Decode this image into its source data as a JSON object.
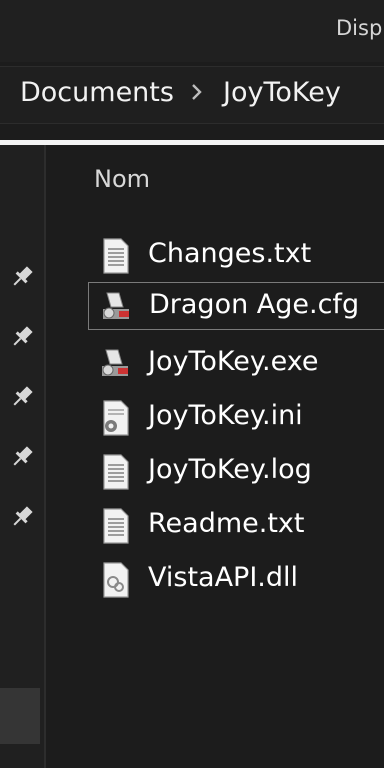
{
  "window": {
    "truncated_title": "Disp"
  },
  "address_bar": {
    "crumbs": [
      "Documents",
      "JoyToKey"
    ]
  },
  "file_list": {
    "column_header": "Nom",
    "files": [
      {
        "name": "Changes.txt",
        "icon": "text-file-icon"
      },
      {
        "name": "Dragon Age.cfg",
        "icon": "config-file-icon"
      },
      {
        "name": "JoyToKey.exe",
        "icon": "application-icon"
      },
      {
        "name": "JoyToKey.ini",
        "icon": "settings-file-icon"
      },
      {
        "name": "JoyToKey.log",
        "icon": "text-file-icon"
      },
      {
        "name": "Readme.txt",
        "icon": "text-file-icon"
      },
      {
        "name": "VistaAPI.dll",
        "icon": "dll-file-icon"
      }
    ],
    "focused_index": 1
  },
  "nav_pane": {
    "pin_icon": "pin-icon",
    "pin_count": 5
  },
  "colors": {
    "background": "#1c1c1c",
    "text": "#ffffff",
    "focus_border": "#7a7a7a"
  }
}
